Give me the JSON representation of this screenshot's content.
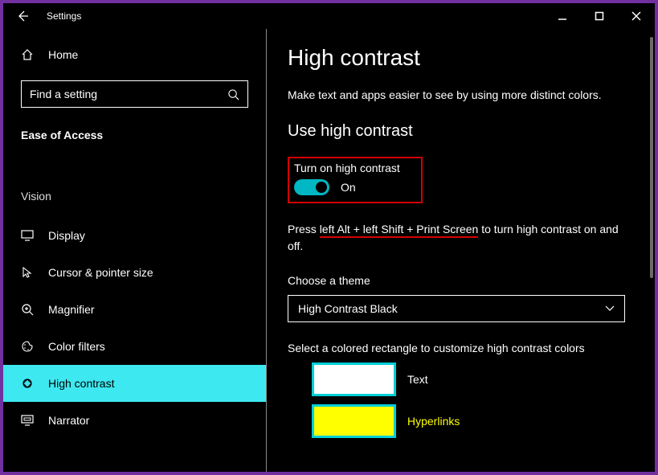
{
  "titlebar": {
    "title": "Settings"
  },
  "sidebar": {
    "home_label": "Home",
    "search_placeholder": "Find a setting",
    "section_title": "Ease of Access",
    "group": "Vision",
    "items": [
      {
        "label": "Display"
      },
      {
        "label": "Cursor & pointer size"
      },
      {
        "label": "Magnifier"
      },
      {
        "label": "Color filters"
      },
      {
        "label": "High contrast"
      },
      {
        "label": "Narrator"
      }
    ]
  },
  "main": {
    "heading": "High contrast",
    "description": "Make text and apps easier to see by using more distinct colors.",
    "subheading": "Use high contrast",
    "toggle_label": "Turn on high contrast",
    "toggle_state": "On",
    "shortcut_prefix": "Press ",
    "shortcut_keys": "left Alt + left Shift + Print Screen",
    "shortcut_suffix": " to turn high contrast on and off.",
    "theme_label": "Choose a theme",
    "theme_value": "High Contrast Black",
    "swatch_intro": "Select a colored rectangle to customize high contrast colors",
    "swatches": [
      {
        "label": "Text"
      },
      {
        "label": "Hyperlinks"
      }
    ]
  }
}
